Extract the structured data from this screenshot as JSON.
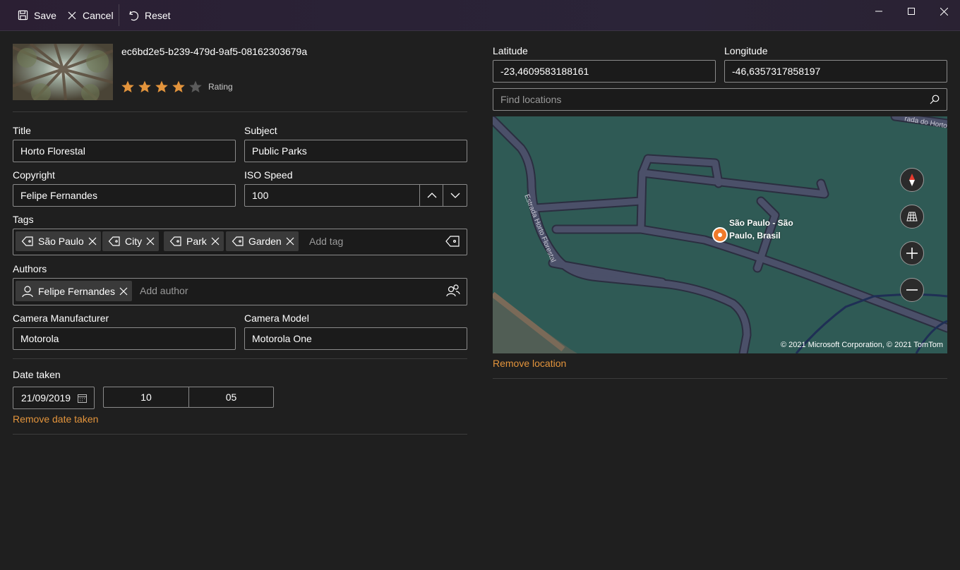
{
  "toolbar": {
    "save_label": "Save",
    "cancel_label": "Cancel",
    "reset_label": "Reset"
  },
  "photo": {
    "id": "ec6bd2e5-b239-479d-9af5-08162303679a",
    "rating": 4,
    "rating_max": 5,
    "rating_label": "Rating"
  },
  "fields": {
    "title_label": "Title",
    "title_value": "Horto Florestal",
    "subject_label": "Subject",
    "subject_value": "Public Parks",
    "copyright_label": "Copyright",
    "copyright_value": "Felipe Fernandes",
    "iso_label": "ISO Speed",
    "iso_value": "100",
    "tags_label": "Tags",
    "tags": [
      "São Paulo",
      "City",
      "Park",
      "Garden"
    ],
    "add_tag_placeholder": "Add tag",
    "authors_label": "Authors",
    "authors": [
      "Felipe Fernandes"
    ],
    "add_author_placeholder": "Add author",
    "camera_manufacturer_label": "Camera Manufacturer",
    "camera_manufacturer_value": "Motorola",
    "camera_model_label": "Camera Model",
    "camera_model_value": "Motorola One"
  },
  "date": {
    "label": "Date taken",
    "date_value": "21/09/2019",
    "hour": "10",
    "minute": "05",
    "remove_label": "Remove date taken"
  },
  "location": {
    "latitude_label": "Latitude",
    "latitude_value": "-23,4609583188161",
    "longitude_label": "Longitude",
    "longitude_value": "-46,6357317858197",
    "search_placeholder": "Find locations",
    "map_pin_label": "São Paulo - São Paulo, Brasil",
    "road_label_1": "Estrada Horto Florestal",
    "road_label_2": "rada do Horto",
    "copyright": "© 2021 Microsoft Corporation, © 2021 TomTom",
    "remove_label": "Remove location"
  },
  "colors": {
    "accent": "#e3943c",
    "star_filled": "#e3943c",
    "star_empty": "#5a5a5a",
    "map_background": "#2f5a55",
    "map_road": "#4a4f66",
    "map_pin": "#f07a2a"
  },
  "icons": {
    "save": "save-icon",
    "cancel": "close-icon",
    "reset": "undo-icon",
    "tag": "tag-icon",
    "person": "person-icon",
    "calendar": "calendar-icon",
    "search": "search-icon",
    "compass": "compass-icon",
    "map_style": "map-style-icon",
    "zoom_in": "plus-icon",
    "zoom_out": "minus-icon"
  }
}
